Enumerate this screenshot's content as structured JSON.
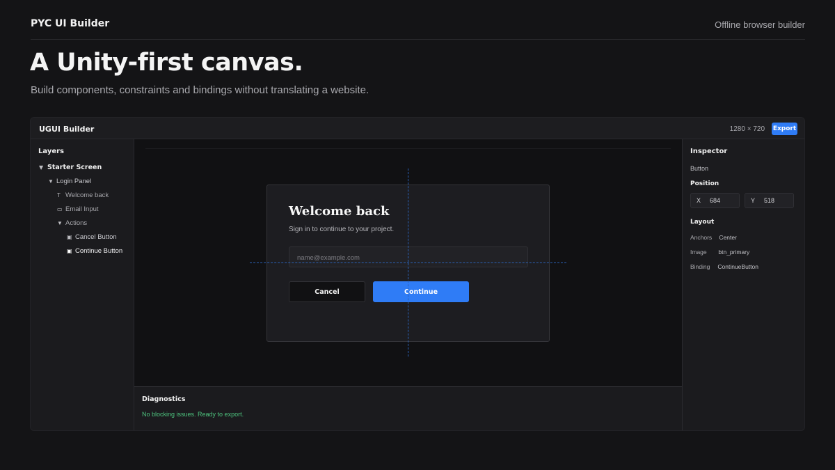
{
  "topbar": {
    "brand": "PYC UI Builder",
    "tagline": "Offline browser builder"
  },
  "hero": {
    "title": "A Unity-first canvas.",
    "subtitle": "Build components, constraints and bindings without translating a website."
  },
  "builder": {
    "title": "UGUI Builder",
    "resolution": "1280 × 720",
    "export_label": "Export",
    "accent_color": "#2f7cf6"
  },
  "layers": {
    "heading": "Layers",
    "items": [
      {
        "label": "Starter Screen",
        "icon": "chevron-down-icon",
        "glyph": "▼"
      },
      {
        "label": "Login Panel",
        "icon": "chevron-down-icon",
        "glyph": "▼"
      },
      {
        "label": "Welcome back",
        "icon": "text-icon",
        "glyph": "T"
      },
      {
        "label": "Email Input",
        "icon": "input-icon",
        "glyph": "▭"
      },
      {
        "label": "Actions",
        "icon": "chevron-down-icon",
        "glyph": "▼"
      },
      {
        "label": "Cancel Button",
        "icon": "button-icon",
        "glyph": "▣"
      },
      {
        "label": "Continue Button",
        "icon": "button-icon",
        "glyph": "▣",
        "selected": true
      }
    ]
  },
  "canvas": {
    "login": {
      "title": "Welcome back",
      "subtitle": "Sign in to continue to your project.",
      "email_placeholder": "name@example.com",
      "cancel_label": "Cancel",
      "continue_label": "Continue"
    }
  },
  "diagnostics": {
    "title": "Diagnostics",
    "message": "No blocking issues. Ready to export.",
    "status_color": "#4ec57f"
  },
  "inspector": {
    "heading": "Inspector",
    "selected_type": "Button",
    "position_heading": "Position",
    "x_label": "X",
    "x_value": "684",
    "y_label": "Y",
    "y_value": "518",
    "layout_heading": "Layout",
    "properties": [
      {
        "key": "Anchors",
        "value": "Center"
      },
      {
        "key": "Image",
        "value": "btn_primary"
      },
      {
        "key": "Binding",
        "value": "ContinueButton"
      }
    ]
  }
}
